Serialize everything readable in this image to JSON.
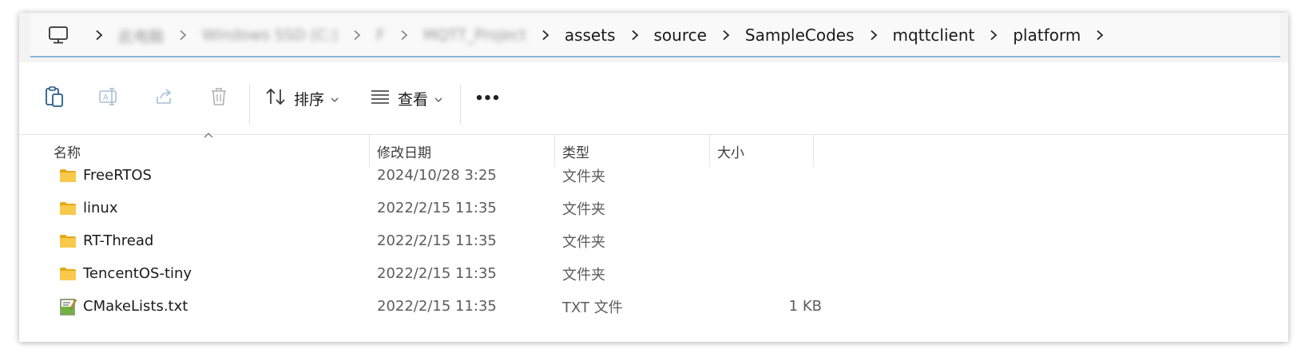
{
  "breadcrumb": {
    "items": [
      {
        "label": "此电脑",
        "blurred": true
      },
      {
        "label": "Windows SSD (C:)",
        "blurred": true
      },
      {
        "label": "F",
        "blurred": true
      },
      {
        "label": "MQTT_Project",
        "blurred": true
      },
      {
        "label": "assets",
        "blurred": false
      },
      {
        "label": "source",
        "blurred": false
      },
      {
        "label": "SampleCodes",
        "blurred": false
      },
      {
        "label": "mqttclient",
        "blurred": false
      },
      {
        "label": "platform",
        "blurred": false
      }
    ]
  },
  "toolbar": {
    "sort_label": "排序",
    "view_label": "查看",
    "more_label": "•••"
  },
  "columns": {
    "name": "名称",
    "date": "修改日期",
    "type": "类型",
    "size": "大小"
  },
  "files": [
    {
      "name": "FreeRTOS",
      "date": "2024/10/28 3:25",
      "type": "文件夹",
      "size": "",
      "icon": "folder-icon"
    },
    {
      "name": "linux",
      "date": "2022/2/15 11:35",
      "type": "文件夹",
      "size": "",
      "icon": "folder-icon"
    },
    {
      "name": "RT-Thread",
      "date": "2022/2/15 11:35",
      "type": "文件夹",
      "size": "",
      "icon": "folder-icon"
    },
    {
      "name": "TencentOS-tiny",
      "date": "2022/2/15 11:35",
      "type": "文件夹",
      "size": "",
      "icon": "folder-icon"
    },
    {
      "name": "CMakeLists.txt",
      "date": "2022/2/15 11:35",
      "type": "TXT 文件",
      "size": "1 KB",
      "icon": "text-file-icon"
    }
  ],
  "colors": {
    "accent": "#8fb3d9",
    "folder": "#f8c94a",
    "folder_dark": "#e4a918",
    "address_bg": "#f9f9f9"
  }
}
